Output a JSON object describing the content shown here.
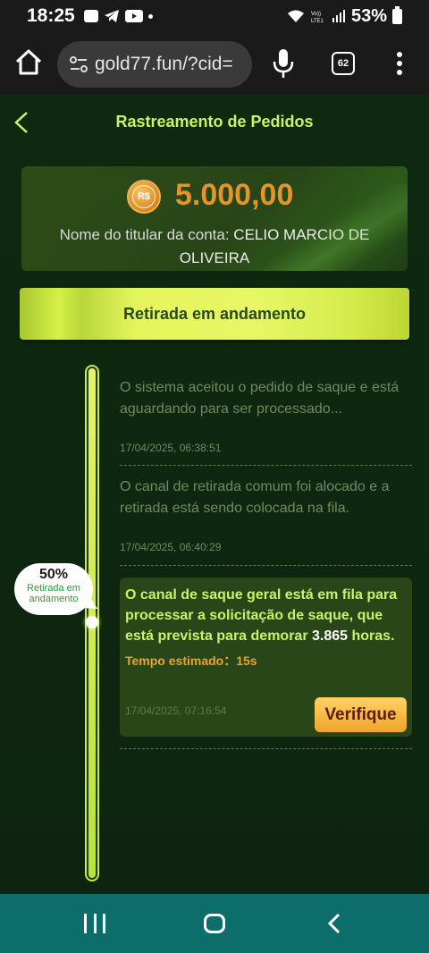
{
  "status_bar": {
    "time": "18:25",
    "battery": "53%"
  },
  "browser": {
    "url": "gold77.fun/?cid=",
    "tab_count": "62"
  },
  "header": {
    "title": "Rastreamento de Pedidos"
  },
  "balance": {
    "currency_symbol": "R$",
    "amount": "5.000,00",
    "holder_label": "Nome do titular da conta:",
    "holder_name": "CELIO MARCIO DE OLIVEIRA"
  },
  "banner": {
    "label": "Retirada em andamento"
  },
  "progress": {
    "percent": "50%",
    "label": "Retirada em andamento",
    "value": 0.5
  },
  "steps": [
    {
      "text": "O sistema aceitou o pedido de saque e está aguardando para ser processado...",
      "time": "17/04/2025, 06:38:51"
    },
    {
      "text": "O canal de retirada comum foi alocado e a retirada está sendo colocada na fila.",
      "time": "17/04/2025, 06:40:29"
    }
  ],
  "active_step": {
    "text": "O canal de saque geral está em fila para processar a solicitação de saque, que está prevista para demorar",
    "hours_value": "3.865",
    "hours_unit": "horas.",
    "eta_label": "Tempo estimado：",
    "eta_value": "15s",
    "time": "17/04/2025, 07:16:54",
    "button_label": "Verifique"
  },
  "colors": {
    "accent": "#c7f36a",
    "amount": "#e3952a",
    "nav": "#0d6d6a"
  }
}
